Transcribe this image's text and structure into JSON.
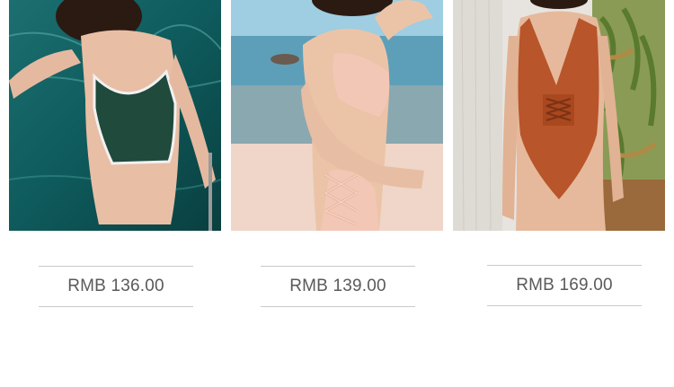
{
  "products": [
    {
      "image_icon": "swimsuit-green-photo",
      "price": "RMB 136.00",
      "swatch": "#1f4a3c"
    },
    {
      "image_icon": "swimsuit-pink-photo",
      "price": "RMB 139.00",
      "swatch": "#f1c6b2"
    },
    {
      "image_icon": "swimsuit-rust-photo",
      "price": "RMB 169.00",
      "swatch": "#b8552a"
    }
  ]
}
